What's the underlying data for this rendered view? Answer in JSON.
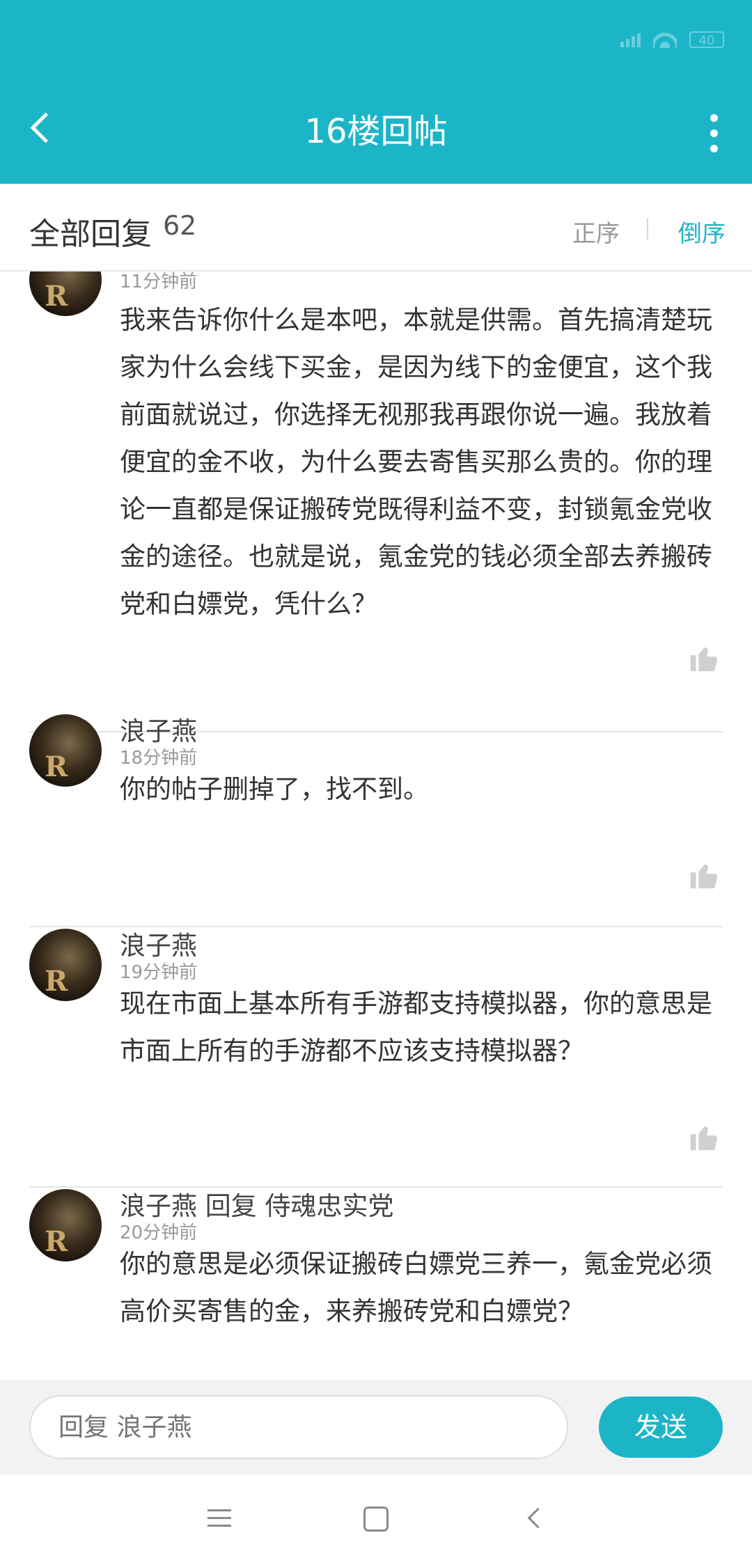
{
  "status_bar": {
    "battery": "40"
  },
  "app_bar": {
    "title": "16楼回帖"
  },
  "header": {
    "label": "全部回复",
    "count": "62",
    "sort_asc": "正序",
    "sort_desc": "倒序"
  },
  "comments": [
    {
      "username": "",
      "time": "11分钟前",
      "content": "我来告诉你什么是本吧，本就是供需。首先搞清楚玩家为什么会线下买金，是因为线下的金便宜，这个我前面就说过，你选择无视那我再跟你说一遍。我放着便宜的金不收，为什么要去寄售买那么贵的。你的理论一直都是保证搬砖党既得利益不变，封锁氪金党收金的途径。也就是说，氪金党的钱必须全部去养搬砖党和白嫖党，凭什么？"
    },
    {
      "username": "浪子燕",
      "time": "18分钟前",
      "content": "你的帖子删掉了，找不到。"
    },
    {
      "username": "浪子燕",
      "time": "19分钟前",
      "content": "现在市面上基本所有手游都支持模拟器，你的意思是市面上所有的手游都不应该支持模拟器？"
    },
    {
      "username": "浪子燕 回复 侍魂忠实党",
      "time": "20分钟前",
      "content": "你的意思是必须保证搬砖白嫖党三养一，氪金党必须高价买寄售的金，来养搬砖党和白嫖党？"
    }
  ],
  "reply_bar": {
    "placeholder": "回复 浪子燕",
    "send_label": "发送"
  },
  "icons": {
    "back": "back-arrow-icon",
    "more": "more-vertical-icon",
    "like": "thumbs-up-icon",
    "avatar_letter": "R"
  },
  "colors": {
    "accent": "#1cb5c8",
    "divider": "#e5e5e5"
  }
}
